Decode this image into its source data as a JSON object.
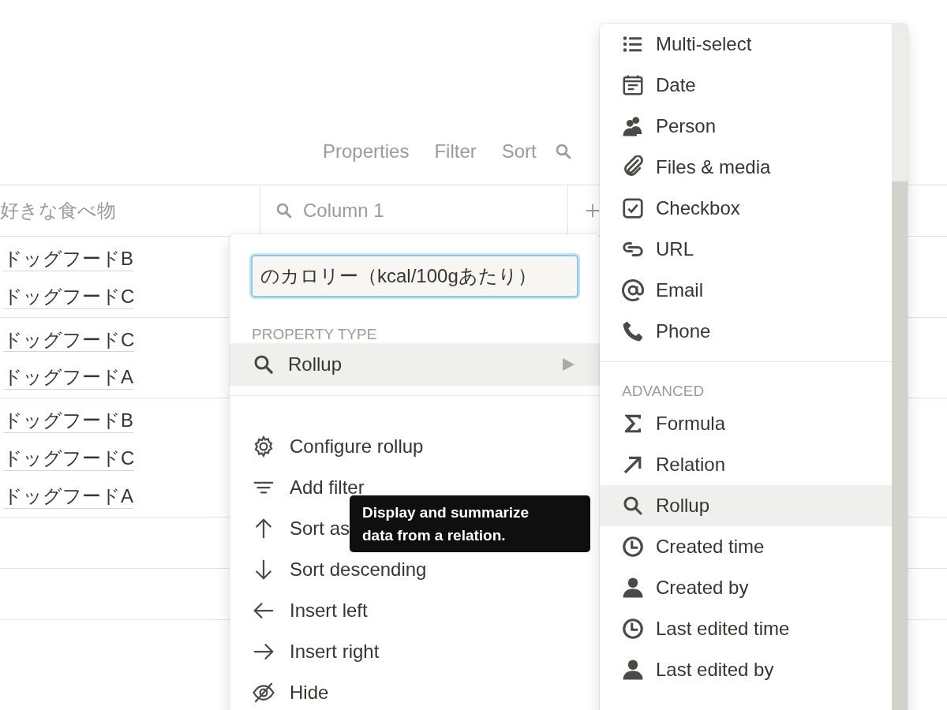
{
  "toolbar": {
    "items": [
      "Properties",
      "Filter",
      "Sort"
    ]
  },
  "table": {
    "columns": [
      "好きな食べ物",
      "Column 1"
    ],
    "rows": [
      {
        "items": [
          "ドッグフードB",
          "ドッグフードC"
        ]
      },
      {
        "items": [
          "ドッグフードC",
          "ドッグフードA"
        ]
      },
      {
        "items": [
          "ドッグフードB",
          "ドッグフードC",
          "ドッグフードA"
        ]
      },
      {
        "items": []
      },
      {
        "items": []
      }
    ]
  },
  "property_menu": {
    "name_value": "のカロリー（kcal/100gあたり）",
    "section": "PROPERTY TYPE",
    "property_type": {
      "label": "Rollup",
      "selected": true
    },
    "actions": [
      {
        "label": "Configure rollup",
        "kind": "gear"
      },
      {
        "label": "Add filter",
        "kind": "filter"
      },
      {
        "label": "Sort as",
        "kind": "up"
      },
      {
        "label": "Sort descending",
        "kind": "down"
      },
      {
        "label": "Insert left",
        "kind": "left"
      },
      {
        "label": "Insert right",
        "kind": "right"
      },
      {
        "label": "Hide",
        "kind": "hide"
      }
    ]
  },
  "tooltip": "Display and summarize data from a relation.",
  "type_menu": {
    "basic": [
      {
        "label": "Multi-select",
        "kind": "multi",
        "selected": false
      },
      {
        "label": "Date",
        "kind": "date",
        "selected": false
      },
      {
        "label": "Person",
        "kind": "person",
        "selected": false
      },
      {
        "label": "Files & media",
        "kind": "files",
        "selected": false
      },
      {
        "label": "Checkbox",
        "kind": "checkbox",
        "selected": false
      },
      {
        "label": "URL",
        "kind": "url",
        "selected": false
      },
      {
        "label": "Email",
        "kind": "email",
        "selected": false
      },
      {
        "label": "Phone",
        "kind": "phone",
        "selected": false
      }
    ],
    "section": "ADVANCED",
    "advanced": [
      {
        "label": "Formula",
        "kind": "formula",
        "selected": false
      },
      {
        "label": "Relation",
        "kind": "relation",
        "selected": false
      },
      {
        "label": "Rollup",
        "kind": "rollup",
        "selected": true
      },
      {
        "label": "Created time",
        "kind": "clock",
        "selected": false
      },
      {
        "label": "Created by",
        "kind": "user",
        "selected": false
      },
      {
        "label": "Last edited time",
        "kind": "clock",
        "selected": false
      },
      {
        "label": "Last edited by",
        "kind": "user",
        "selected": false
      }
    ]
  }
}
